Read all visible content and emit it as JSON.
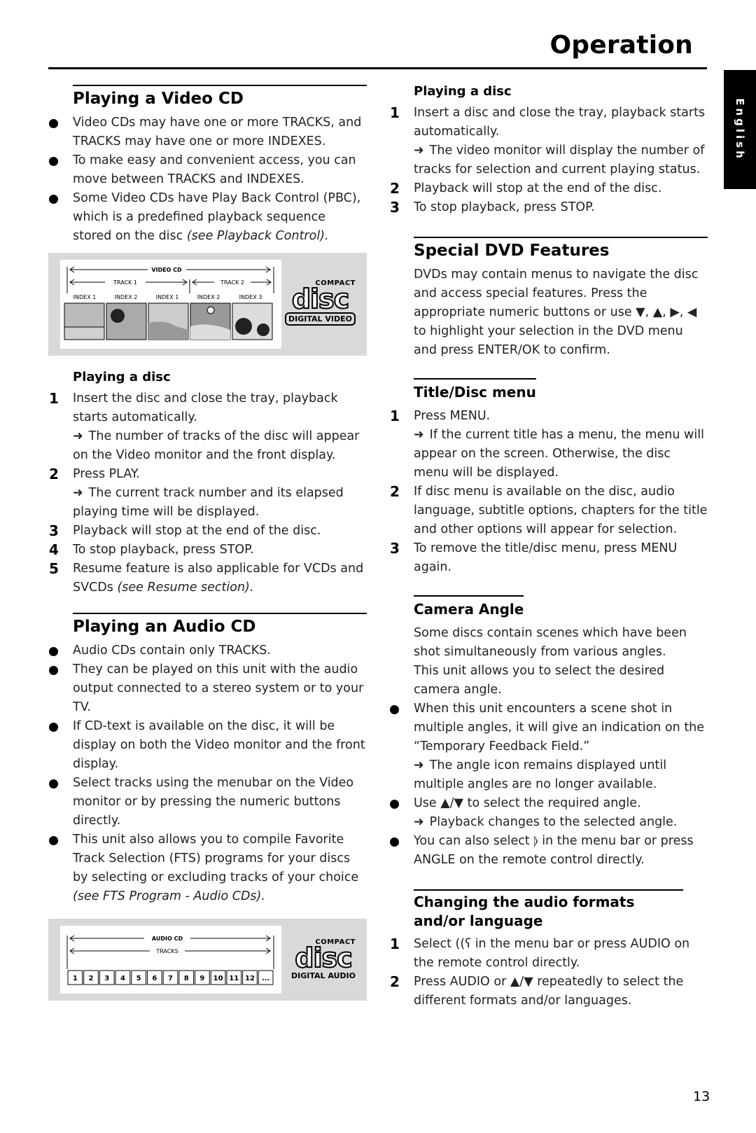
{
  "header": {
    "title": "Operation",
    "language_tab": "English"
  },
  "left": {
    "video_cd": {
      "title": "Playing a Video CD",
      "bullets": [
        "Video CDs may have one or more TRACKS, and TRACKS may have one or more INDEXES.",
        "To make easy and convenient access, you can move between TRACKS and INDEXES.",
        "Some Video CDs have Play Back Control (PBC), which is a predefined playback sequence stored on the disc "
      ],
      "bullet3_ref": "(see Playback Control).",
      "figure": {
        "disc_label": "VIDEO CD",
        "tracks": [
          "TRACK 1",
          "TRACK 2"
        ],
        "indexes": [
          "INDEX 1",
          "INDEX 2",
          "INDEX 1",
          "INDEX 2",
          "INDEX 3"
        ],
        "logo_top": "COMPACT",
        "logo_main": "disc",
        "logo_sub": "DIGITAL VIDEO"
      },
      "playing_title": "Playing a disc",
      "steps": [
        {
          "n": "1",
          "text": "Insert the disc and close the tray, playback starts automatically.",
          "result": "The number of tracks of the disc will appear on the Video monitor and the front display."
        },
        {
          "n": "2",
          "text": "Press PLAY.",
          "result": "The current track number and its elapsed playing time will be displayed."
        },
        {
          "n": "3",
          "text": "Playback will stop at the end of the disc."
        },
        {
          "n": "4",
          "text": "To stop playback, press STOP."
        },
        {
          "n": "5",
          "text": "Resume feature is also applicable for VCDs and SVCDs ",
          "ref": "(see Resume section)."
        }
      ]
    },
    "audio_cd": {
      "title": "Playing an Audio CD",
      "bullets": [
        "Audio CDs contain only TRACKS.",
        "They can be played on this unit with the audio output connected to a stereo system or to your TV.",
        "If CD-text is available on the disc, it will be display on both the Video monitor and the front display.",
        "Select tracks using the menubar on the Video monitor or by pressing the numeric buttons directly.",
        "This unit also allows you to compile Favorite Track Selection (FTS) programs for your discs by selecting or excluding tracks of your choice "
      ],
      "bullet5_ref": "(see FTS Program - Audio CDs).",
      "figure": {
        "disc_label": "AUDIO CD",
        "tracks_label": "TRACKS",
        "track_numbers": [
          "1",
          "2",
          "3",
          "4",
          "5",
          "6",
          "7",
          "8",
          "9",
          "10",
          "11",
          "12",
          "..."
        ],
        "logo_top": "COMPACT",
        "logo_main": "disc",
        "logo_sub": "DIGITAL AUDIO"
      }
    }
  },
  "right": {
    "playing": {
      "title": "Playing a disc",
      "steps": [
        {
          "n": "1",
          "text": "Insert a disc and close the tray, playback starts automatically.",
          "result": "The video monitor will display the number of tracks for selection and current playing status."
        },
        {
          "n": "2",
          "text": "Playback will stop at the end of the disc."
        },
        {
          "n": "3",
          "text": "To stop playback, press STOP."
        }
      ]
    },
    "special_dvd": {
      "title": "Special DVD Features",
      "body": "DVDs may contain menus to navigate the disc and access special features. Press the appropriate numeric buttons or use ▼, ▲, ▶, ◀ to highlight your selection in the DVD menu and press ENTER/OK to confirm."
    },
    "title_menu": {
      "title": "Title/Disc menu",
      "steps": [
        {
          "n": "1",
          "text": "Press MENU.",
          "result": "If the current title has a menu, the menu will appear on the screen. Otherwise, the disc menu will be displayed."
        },
        {
          "n": "2",
          "text": "If disc menu is available on the disc, audio language, subtitle options, chapters for the title and other options will appear for selection."
        },
        {
          "n": "3",
          "text": "To remove the title/disc menu, press MENU again."
        }
      ]
    },
    "camera_angle": {
      "title": "Camera Angle",
      "intro1": "Some discs contain scenes which have been shot simultaneously from various angles.",
      "intro2": "This unit allows you to select the desired camera angle.",
      "bullets": [
        {
          "text": "When this unit encounters a scene shot in multiple angles, it will give an indication on the “Temporary Feedback Field.”",
          "result": "The angle icon remains displayed until multiple angles are no longer available."
        },
        {
          "text": "Use ▲/▼ to select the required angle.",
          "result": "Playback changes to the selected angle."
        },
        {
          "text": "You can also select ⦊ in the menu bar or press ANGLE on the remote control directly."
        }
      ]
    },
    "audio_formats": {
      "title": "Changing the audio formats and/or language",
      "steps": [
        {
          "n": "1",
          "text": "Select ((ʕ in the menu bar or press AUDIO on the remote control directly."
        },
        {
          "n": "2",
          "text": "Press AUDIO or ▲/▼ repeatedly to select the different formats and/or languages."
        }
      ]
    }
  },
  "footer": {
    "page_number": "13"
  },
  "arrow_glyph": "➜"
}
